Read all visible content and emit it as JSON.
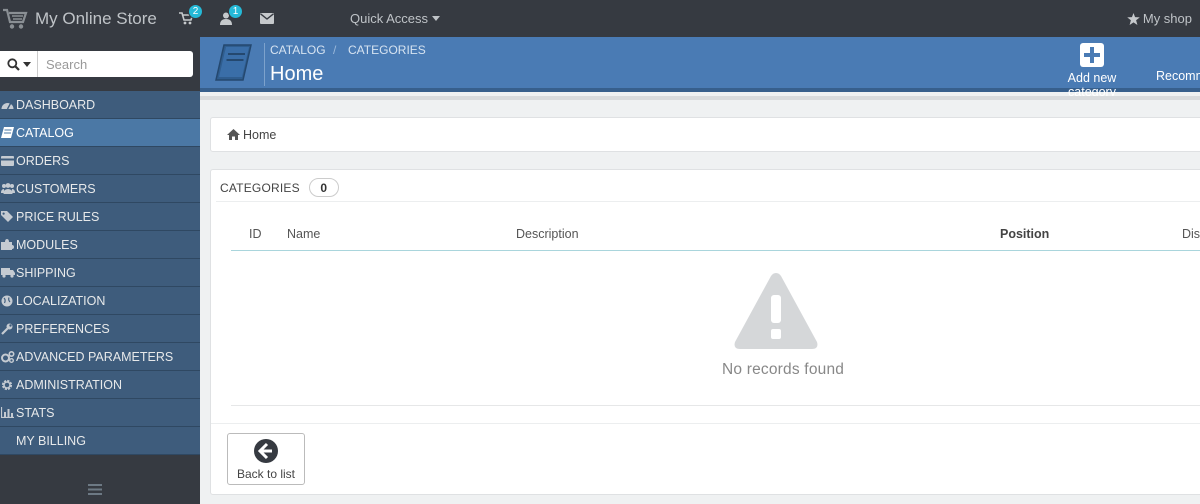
{
  "header": {
    "shop_name": "My Online Store",
    "cart_badge": "2",
    "customers_badge": "1",
    "quick_access": "Quick Access",
    "my_shop": "My shop"
  },
  "sidebar": {
    "search_placeholder": "Search",
    "items": [
      {
        "label": "DASHBOARD",
        "icon": "dashboard-icon",
        "active": false
      },
      {
        "label": "CATALOG",
        "icon": "book-icon",
        "active": true
      },
      {
        "label": "ORDERS",
        "icon": "credit-card-icon",
        "active": false
      },
      {
        "label": "CUSTOMERS",
        "icon": "users-icon",
        "active": false
      },
      {
        "label": "PRICE RULES",
        "icon": "tags-icon",
        "active": false
      },
      {
        "label": "MODULES",
        "icon": "puzzle-icon",
        "active": false
      },
      {
        "label": "SHIPPING",
        "icon": "truck-icon",
        "active": false
      },
      {
        "label": "LOCALIZATION",
        "icon": "globe-icon",
        "active": false
      },
      {
        "label": "PREFERENCES",
        "icon": "wrench-icon",
        "active": false
      },
      {
        "label": "ADVANCED PARAMETERS",
        "icon": "cogs-icon",
        "active": false
      },
      {
        "label": "ADMINISTRATION",
        "icon": "cog-icon",
        "active": false
      },
      {
        "label": "STATS",
        "icon": "bar-chart-icon",
        "active": false
      },
      {
        "label": "MY BILLING",
        "icon": "",
        "active": false
      }
    ]
  },
  "toolbar": {
    "breadcrumb_catalog": "CATALOG",
    "breadcrumb_separator": "/",
    "breadcrumb_categories": "CATEGORIES",
    "title": "Home",
    "add_new_category": "Add new category",
    "recommended": "Recomm"
  },
  "breadcrumb": {
    "home": "Home"
  },
  "categories": {
    "heading": "CATEGORIES",
    "count": "0",
    "columns": [
      "ID",
      "Name",
      "Description",
      "Position",
      "Dis"
    ],
    "empty_message": "No records found",
    "back_to_list": "Back to list"
  },
  "colors": {
    "topbar": "#363a41",
    "sidebar_item": "#3e5c7c",
    "sidebar_active": "#4b78a5",
    "toolbar": "#4a7bb4",
    "badge": "#25b9d7"
  }
}
